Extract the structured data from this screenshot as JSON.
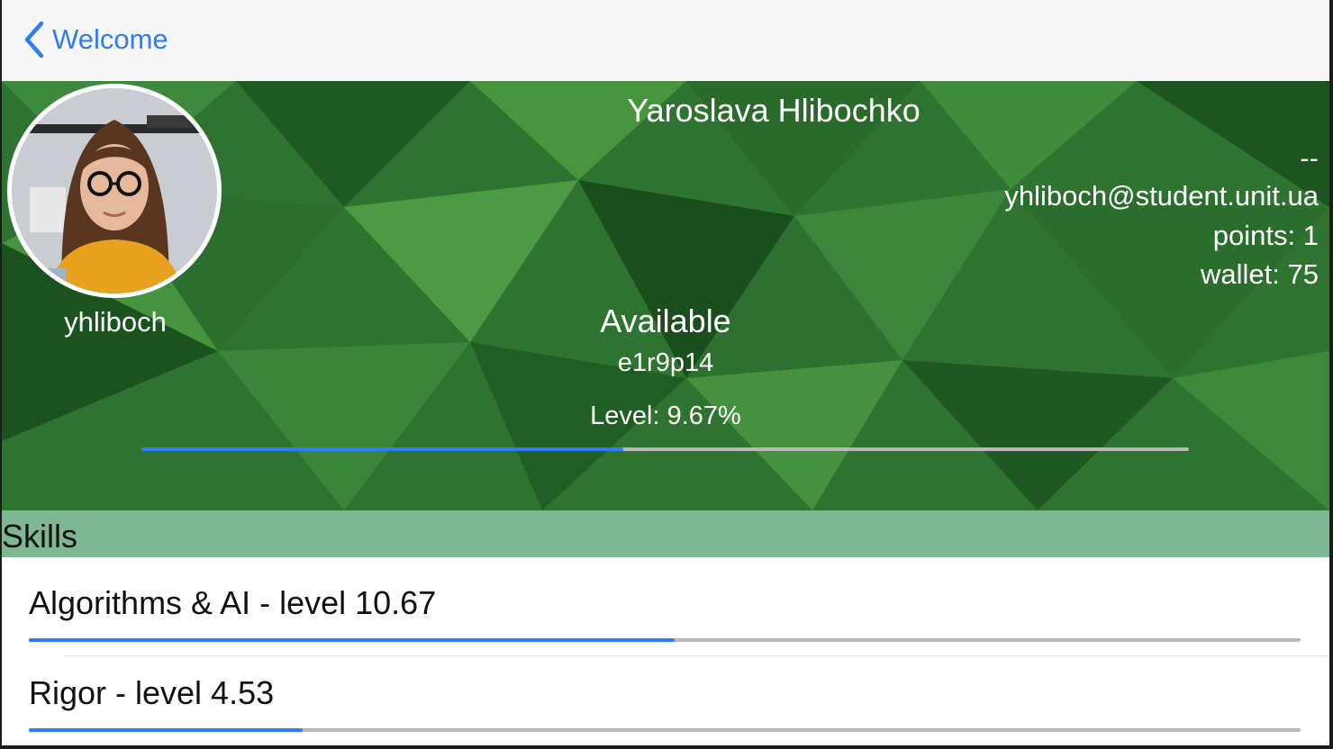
{
  "nav": {
    "back_label": "Welcome"
  },
  "profile": {
    "full_name": "Yaroslava Hlibochko",
    "phone": "--",
    "email": "yhliboch@student.unit.ua",
    "points": "points: 1",
    "wallet": "wallet: 75",
    "login": "yhliboch",
    "status": "Available",
    "location": "e1r9p14",
    "level_text": "Level: 9.67%",
    "level_progress": 0.46
  },
  "section": {
    "title": "Skills"
  },
  "skills": [
    {
      "label": "Algorithms & AI - level 10.67",
      "progress": 0.508
    },
    {
      "label": "Rigor - level 4.53",
      "progress": 0.215
    }
  ],
  "colors": {
    "accent": "#2f7cf6",
    "header_green": "#2f7a33",
    "section_green": "#7db793",
    "track_gray": "#b8b8b8"
  }
}
